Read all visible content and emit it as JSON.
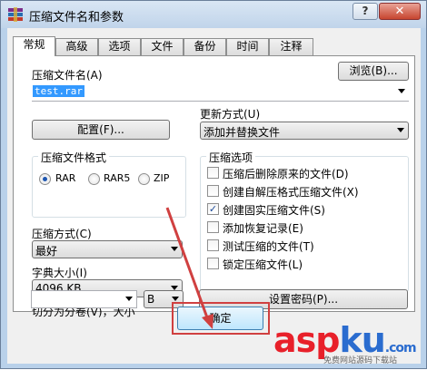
{
  "window": {
    "title": "压缩文件名和参数",
    "help": "?",
    "close": "✕"
  },
  "tabs": [
    "常规",
    "高级",
    "选项",
    "文件",
    "备份",
    "时间",
    "注释"
  ],
  "archive_name": {
    "label": "压缩文件名(A)",
    "value": "test.rar",
    "browse": "浏览(B)..."
  },
  "update_mode": {
    "label": "更新方式(U)",
    "value": "添加并替换文件"
  },
  "profiles_button": "配置(F)...",
  "format": {
    "title": "压缩文件格式",
    "options": [
      "RAR",
      "RAR5",
      "ZIP"
    ],
    "selected": "RAR"
  },
  "options": {
    "title": "压缩选项",
    "items": [
      {
        "label": "压缩后删除原来的文件(D)",
        "checked": false
      },
      {
        "label": "创建自解压格式压缩文件(X)",
        "checked": false
      },
      {
        "label": "创建固实压缩文件(S)",
        "checked": true
      },
      {
        "label": "添加恢复记录(E)",
        "checked": false
      },
      {
        "label": "测试压缩的文件(T)",
        "checked": false
      },
      {
        "label": "锁定压缩文件(L)",
        "checked": false
      }
    ]
  },
  "method": {
    "label": "压缩方式(C)",
    "value": "最好"
  },
  "dictionary": {
    "label": "字典大小(I)",
    "value": "4096 KB"
  },
  "split": {
    "label": "切分为分卷(V)，大小",
    "value": "",
    "unit": "B"
  },
  "password_button": "设置密码(P)...",
  "ok_button": "确定",
  "watermark": {
    "brand_a": "asp",
    "brand_b": "ku",
    "domain": ".com",
    "sub": "免费网站源码下载站"
  },
  "colors": {
    "annotation": "#d04040",
    "accent": "#3399ff"
  }
}
